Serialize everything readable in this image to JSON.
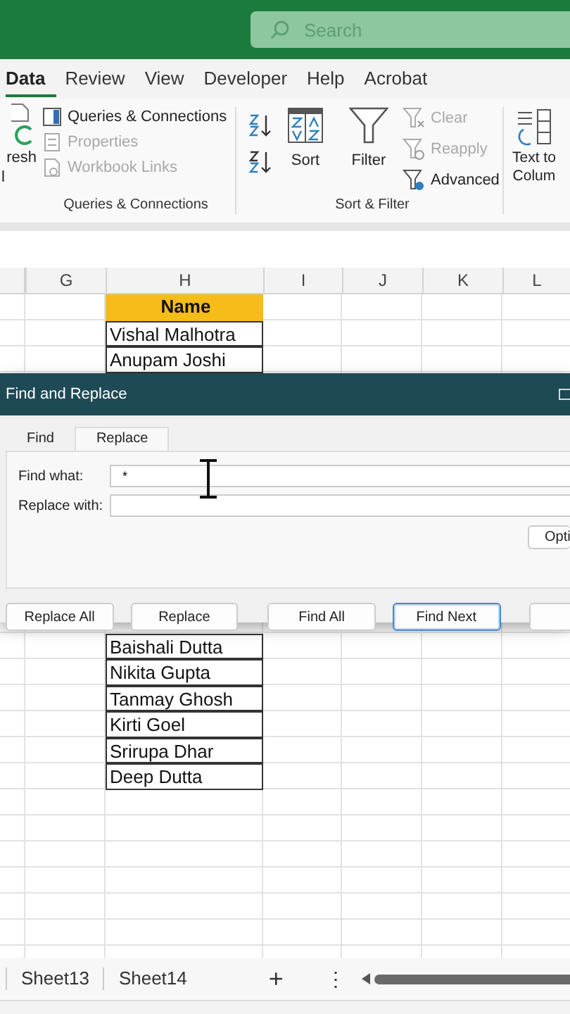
{
  "title_bar": {
    "search": {
      "placeholder": "Search"
    }
  },
  "ribbon_tabs": [
    {
      "label": "Data",
      "selected": true
    },
    {
      "label": "Review",
      "selected": false
    },
    {
      "label": "View",
      "selected": false
    },
    {
      "label": "Developer",
      "selected": false
    },
    {
      "label": "Help",
      "selected": false
    },
    {
      "label": "Acrobat",
      "selected": false
    }
  ],
  "ribbon": {
    "refresh_cut": {
      "line_1": "resh",
      "line_2": "l"
    },
    "queries_group": {
      "items": [
        {
          "label": "Queries & Connections",
          "disabled": false
        },
        {
          "label": "Properties",
          "disabled": true
        },
        {
          "label": "Workbook Links",
          "disabled": true
        }
      ],
      "label": "Queries & Connections"
    },
    "sort_filter_group": {
      "sort": "Sort",
      "filter": "Filter",
      "items": [
        {
          "label": "Clear",
          "disabled": true
        },
        {
          "label": "Reapply",
          "disabled": true
        },
        {
          "label": "Advanced",
          "disabled": false
        }
      ],
      "label": "Sort & Filter"
    },
    "text_to_columns_cut": {
      "line_1": "Text to",
      "line_2": "Colum"
    }
  },
  "grid": {
    "columns": [
      "G",
      "H",
      "I",
      "J",
      "K",
      "L"
    ],
    "rows_above": [
      {
        "text": "Name",
        "kind": "header"
      },
      {
        "text": "Vishal Malhotra",
        "kind": "entry"
      },
      {
        "text": "Anupam Joshi",
        "kind": "entry"
      }
    ],
    "rows_below": [
      {
        "text": "Baishali Dutta",
        "kind": "entry"
      },
      {
        "text": "Nikita Gupta",
        "kind": "entry"
      },
      {
        "text": "Tanmay Ghosh",
        "kind": "entry"
      },
      {
        "text": "Kirti Goel",
        "kind": "entry"
      },
      {
        "text": "Srirupa Dhar",
        "kind": "entry"
      },
      {
        "text": "Deep Dutta",
        "kind": "entry"
      }
    ]
  },
  "dialog": {
    "title": "Find and Replace",
    "tabs": [
      {
        "label": "Find",
        "selected": false
      },
      {
        "label": "Replace",
        "selected": true
      }
    ],
    "find_what": {
      "label": "Find what:",
      "value": "*"
    },
    "replace_with": {
      "label": "Replace with:"
    },
    "options_button": "Opti",
    "buttons": [
      {
        "label": "Replace All",
        "focused": false
      },
      {
        "label": "Replace",
        "focused": false
      },
      {
        "label": "Find All",
        "focused": false
      },
      {
        "label": "Find Next",
        "focused": true
      }
    ]
  },
  "sheet_tabs": [
    {
      "label": "Sheet13"
    },
    {
      "label": "Sheet14"
    }
  ],
  "add_sheet": "+",
  "sheet_menu": "⋮"
}
